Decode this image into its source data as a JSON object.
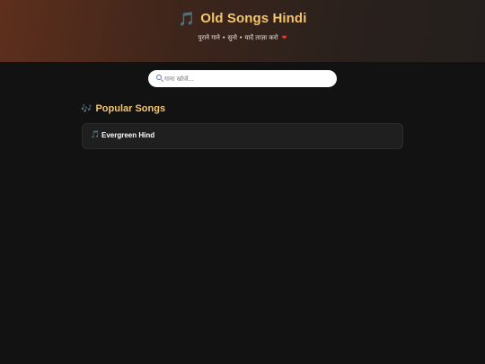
{
  "header": {
    "title_icon": "🎵",
    "title": "Old Songs Hindi",
    "tagline": "पुराने गाने • सुनो • यादें ताज़ा करो",
    "tagline_icon": "❤",
    "colors": {
      "accent": "#f3c56d",
      "gradient_start": "#5e2f1c",
      "gradient_end": "#241f1d"
    }
  },
  "search": {
    "icon": "search-icon",
    "placeholder": "गाना खोजें...",
    "value": ""
  },
  "section": {
    "icon": "🎶",
    "title": "Popular Songs"
  },
  "songs": [
    {
      "icon": "🎵",
      "label": "Evergreen Hind"
    }
  ],
  "theme": {
    "background": "#121212",
    "card_background": "#1f1f1f"
  }
}
